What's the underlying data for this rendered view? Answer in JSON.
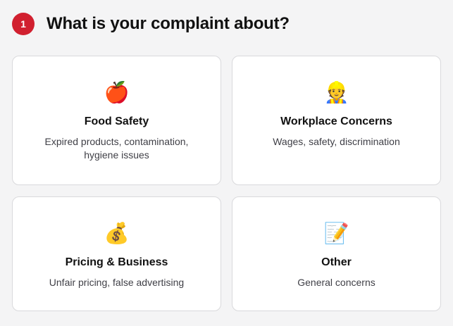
{
  "step": {
    "number": "1"
  },
  "question": {
    "title": "What is your complaint about?"
  },
  "colors": {
    "badge": "#d1202f",
    "background": "#f4f4f5",
    "card": "#ffffff",
    "card_border": "#d9d9dc"
  },
  "options": [
    {
      "icon": "🍎",
      "icon_name": "apple-icon",
      "title": "Food Safety",
      "description": "Expired products, contamination, hygiene issues"
    },
    {
      "icon": "👷",
      "icon_name": "construction-worker-icon",
      "title": "Workplace Concerns",
      "description": "Wages, safety, discrimination"
    },
    {
      "icon": "💰",
      "icon_name": "money-bag-icon",
      "title": "Pricing & Business",
      "description": "Unfair pricing, false advertising"
    },
    {
      "icon": "📝",
      "icon_name": "memo-icon",
      "title": "Other",
      "description": "General concerns"
    }
  ]
}
